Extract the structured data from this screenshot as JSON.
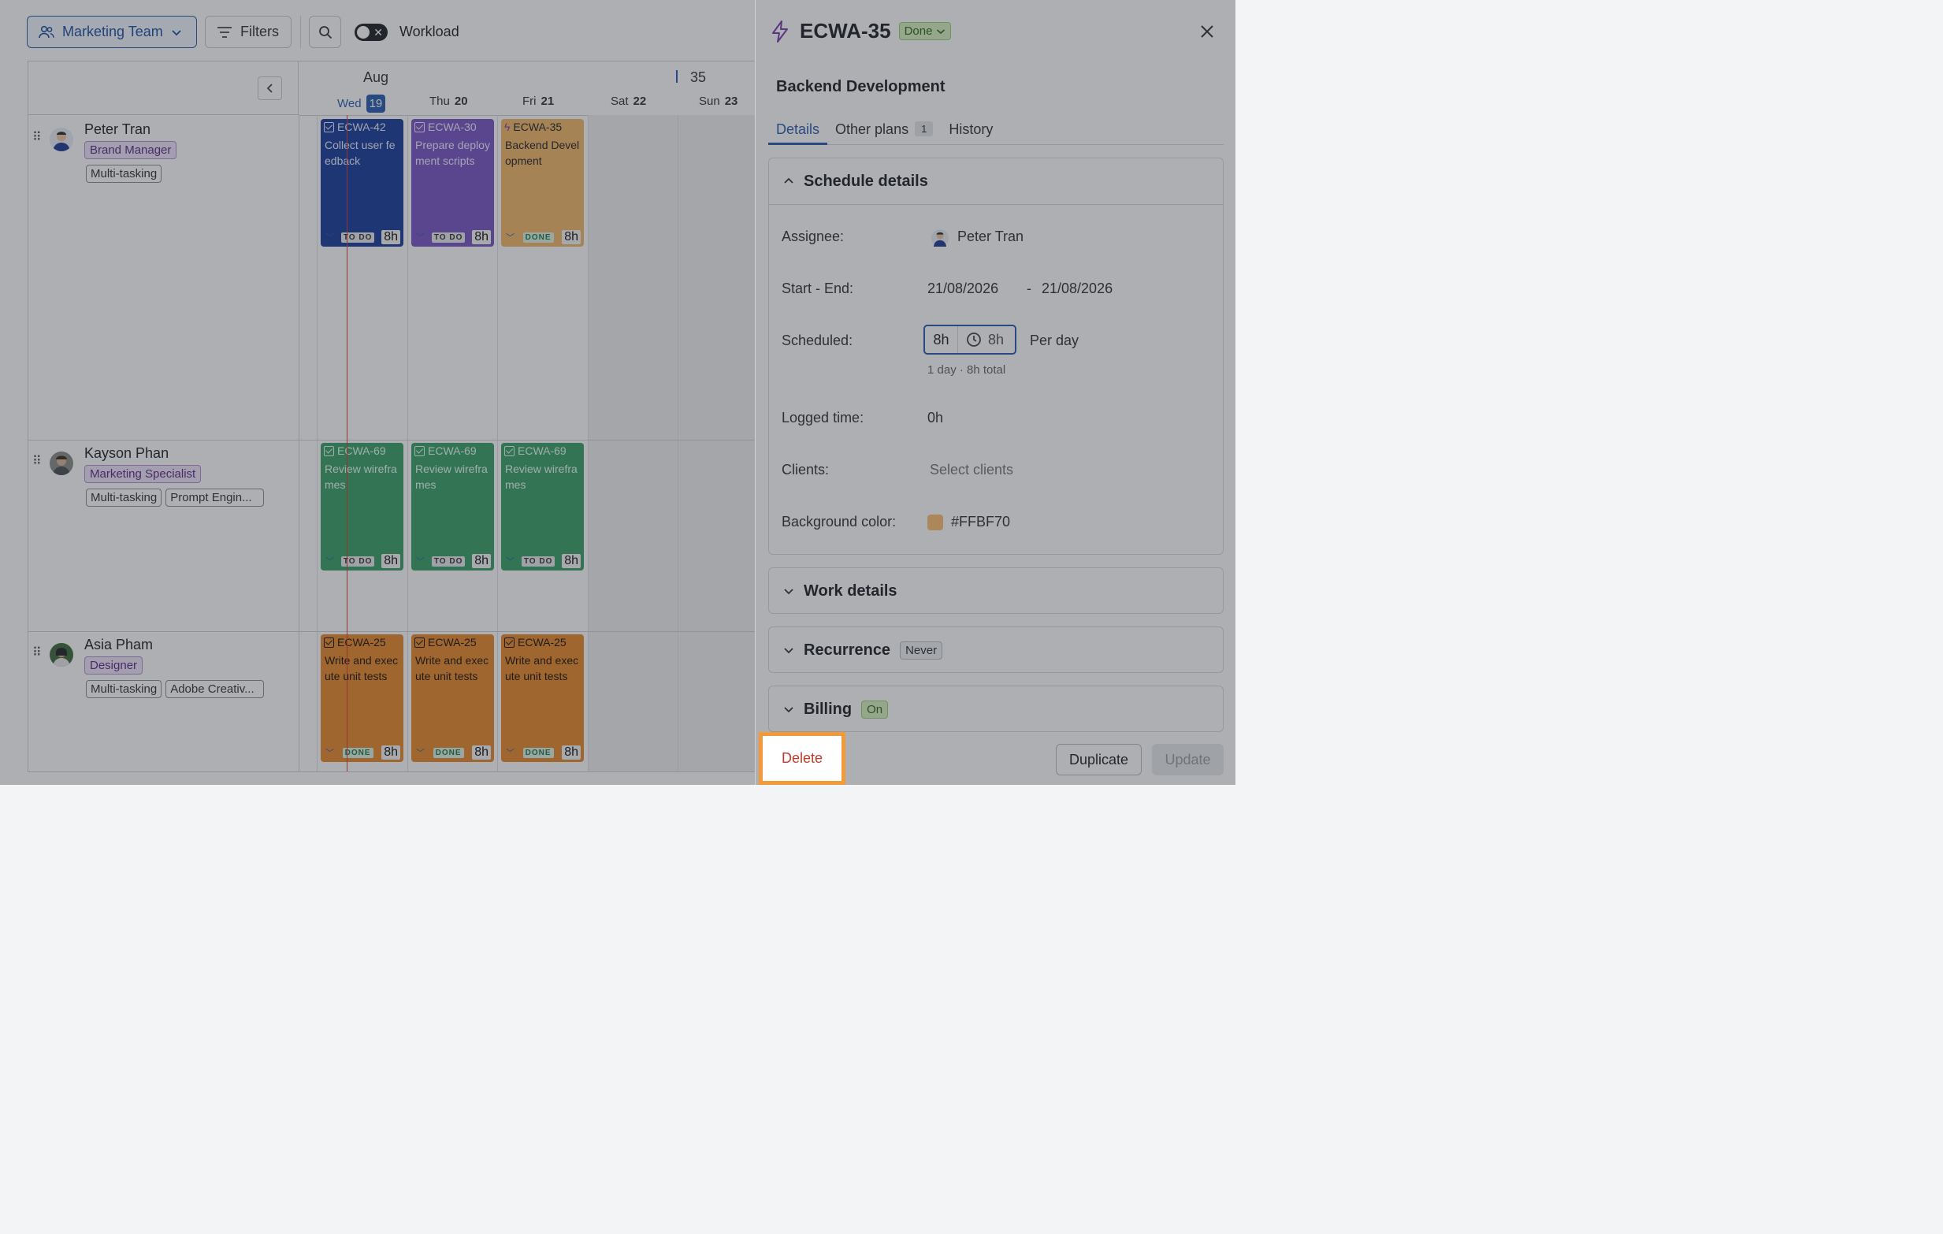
{
  "toolbar": {
    "team_label": "Marketing Team",
    "filters_label": "Filters",
    "workload_label": "Workload"
  },
  "calendar": {
    "month": "Aug",
    "week_number": "35",
    "days": [
      {
        "dow": "Wed",
        "num": "19",
        "today": true
      },
      {
        "dow": "Thu",
        "num": "20"
      },
      {
        "dow": "Fri",
        "num": "21"
      },
      {
        "dow": "Sat",
        "num": "22"
      },
      {
        "dow": "Sun",
        "num": "23"
      }
    ]
  },
  "people": [
    {
      "name": "Peter Tran",
      "role": "Brand Manager",
      "tags": [
        "Multi-tasking"
      ],
      "tasks": [
        {
          "code": "ECWA-42",
          "title": "Collect user feedback",
          "status": "TO DO",
          "hours": "8h",
          "color": "blue"
        },
        {
          "code": "ECWA-30",
          "title": "Prepare deployment scripts",
          "status": "TO DO",
          "hours": "8h",
          "color": "purple"
        },
        {
          "code": "ECWA-35",
          "title": "Backend Development",
          "status": "DONE",
          "hours": "8h",
          "color": "gold"
        }
      ]
    },
    {
      "name": "Kayson Phan",
      "role": "Marketing Specialist",
      "tags": [
        "Multi-tasking",
        "Prompt Engin..."
      ],
      "tasks": [
        {
          "code": "ECWA-69",
          "title": "Review wireframes",
          "status": "TO DO",
          "hours": "8h",
          "color": "green"
        },
        {
          "code": "ECWA-69",
          "title": "Review wireframes",
          "status": "TO DO",
          "hours": "8h",
          "color": "green"
        },
        {
          "code": "ECWA-69",
          "title": "Review wireframes",
          "status": "TO DO",
          "hours": "8h",
          "color": "green"
        }
      ]
    },
    {
      "name": "Asia Pham",
      "role": "Designer",
      "tags": [
        "Multi-tasking",
        "Adobe Creativ..."
      ],
      "tasks": [
        {
          "code": "ECWA-25",
          "title": "Write and execute unit tests",
          "status": "DONE",
          "hours": "8h",
          "color": "orange"
        },
        {
          "code": "ECWA-25",
          "title": "Write and execute unit tests",
          "status": "DONE",
          "hours": "8h",
          "color": "orange"
        },
        {
          "code": "ECWA-25",
          "title": "Write and execute unit tests",
          "status": "DONE",
          "hours": "8h",
          "color": "orange"
        }
      ]
    }
  ],
  "drawer": {
    "issue_key": "ECWA-35",
    "status": "Done",
    "title": "Backend Development",
    "tabs": [
      {
        "label": "Details",
        "active": true
      },
      {
        "label": "Other plans",
        "count": "1"
      },
      {
        "label": "History"
      }
    ],
    "schedule": {
      "heading": "Schedule details",
      "assignee_label": "Assignee:",
      "assignee": "Peter Tran",
      "start_end_label": "Start - End:",
      "start": "21/08/2026",
      "dash": "-",
      "end": "21/08/2026",
      "scheduled_label": "Scheduled:",
      "scheduled_hours": "8h",
      "scheduled_total": "8h",
      "per_day": "Per day",
      "summary": "1 day · 8h total",
      "logged_label": "Logged time:",
      "logged": "0h",
      "clients_label": "Clients:",
      "clients_placeholder": "Select clients",
      "bg_label": "Background color:",
      "bg_value": "#FFBF70"
    },
    "work_details": "Work details",
    "recurrence": {
      "heading": "Recurrence",
      "value": "Never"
    },
    "billing": {
      "heading": "Billing",
      "value": "On"
    },
    "buttons": {
      "delete": "Delete",
      "duplicate": "Duplicate",
      "update": "Update"
    }
  },
  "colors": {
    "accent": "#2a5db0",
    "task_bg": "#FFBF70",
    "highlight": "#f29a3a"
  }
}
